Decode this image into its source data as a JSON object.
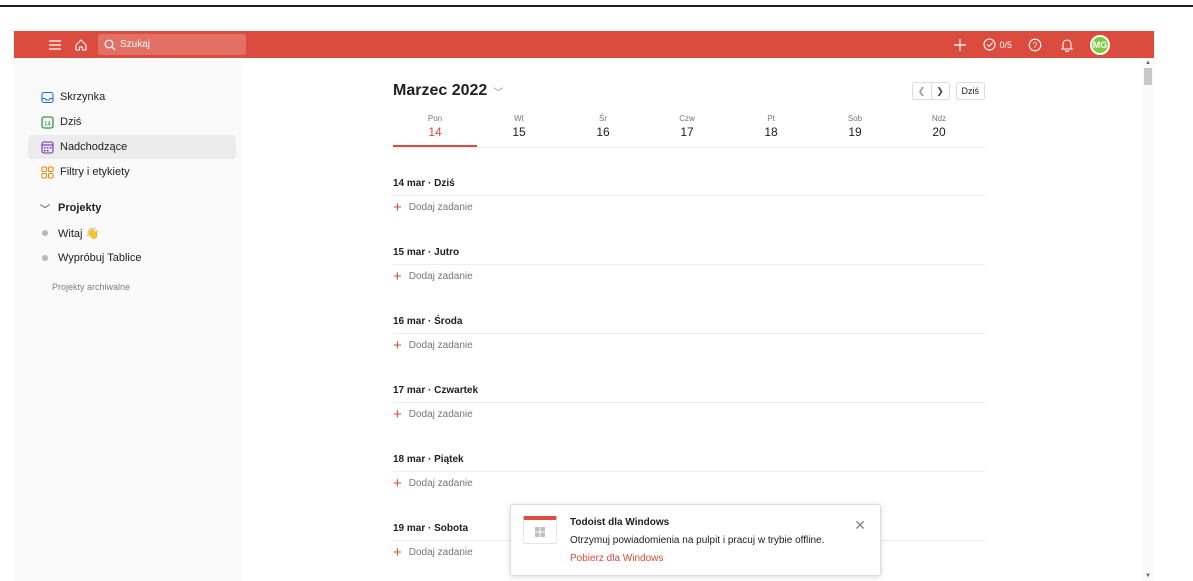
{
  "search": {
    "placeholder": "Szukaj"
  },
  "topbar": {
    "karma": "0/5",
    "avatar_initials": "MG"
  },
  "sidebar": {
    "items": [
      {
        "label": "Skrzynka",
        "icon": "inbox-icon"
      },
      {
        "label": "Dziś",
        "icon": "today-icon",
        "badge": "14"
      },
      {
        "label": "Nadchodzące",
        "icon": "upcoming-icon"
      },
      {
        "label": "Filtry i etykiety",
        "icon": "filters-icon"
      }
    ],
    "projects_label": "Projekty",
    "projects": [
      {
        "label": "Witaj 👋"
      },
      {
        "label": "Wypróbuj Tablice"
      }
    ],
    "archived": "Projekty archiwalne"
  },
  "calendar": {
    "month": "Marzec 2022",
    "today_button": "Dziś",
    "days": [
      {
        "name": "Pon",
        "date": "14"
      },
      {
        "name": "Wt",
        "date": "15"
      },
      {
        "name": "Śr",
        "date": "16"
      },
      {
        "name": "Czw",
        "date": "17"
      },
      {
        "name": "Pt",
        "date": "18"
      },
      {
        "name": "Sob",
        "date": "19"
      },
      {
        "name": "Ndz",
        "date": "20"
      }
    ]
  },
  "sections": [
    {
      "title": "14 mar · Dziś",
      "add": "Dodaj zadanie"
    },
    {
      "title": "15 mar · Jutro",
      "add": "Dodaj zadanie"
    },
    {
      "title": "16 mar · Środa",
      "add": "Dodaj zadanie"
    },
    {
      "title": "17 mar · Czwartek",
      "add": "Dodaj zadanie"
    },
    {
      "title": "18 mar · Piątek",
      "add": "Dodaj zadanie"
    },
    {
      "title": "19 mar · Sobota",
      "add": "Dodaj zadanie"
    }
  ],
  "toast": {
    "title": "Todoist dla Windows",
    "message": "Otrzymuj powiadomienia na pulpit i pracuj w trybie offline.",
    "link": "Pobierz dla Windows"
  },
  "colors": {
    "accent": "#db4c3f",
    "avatar": "#7ecb3f"
  }
}
